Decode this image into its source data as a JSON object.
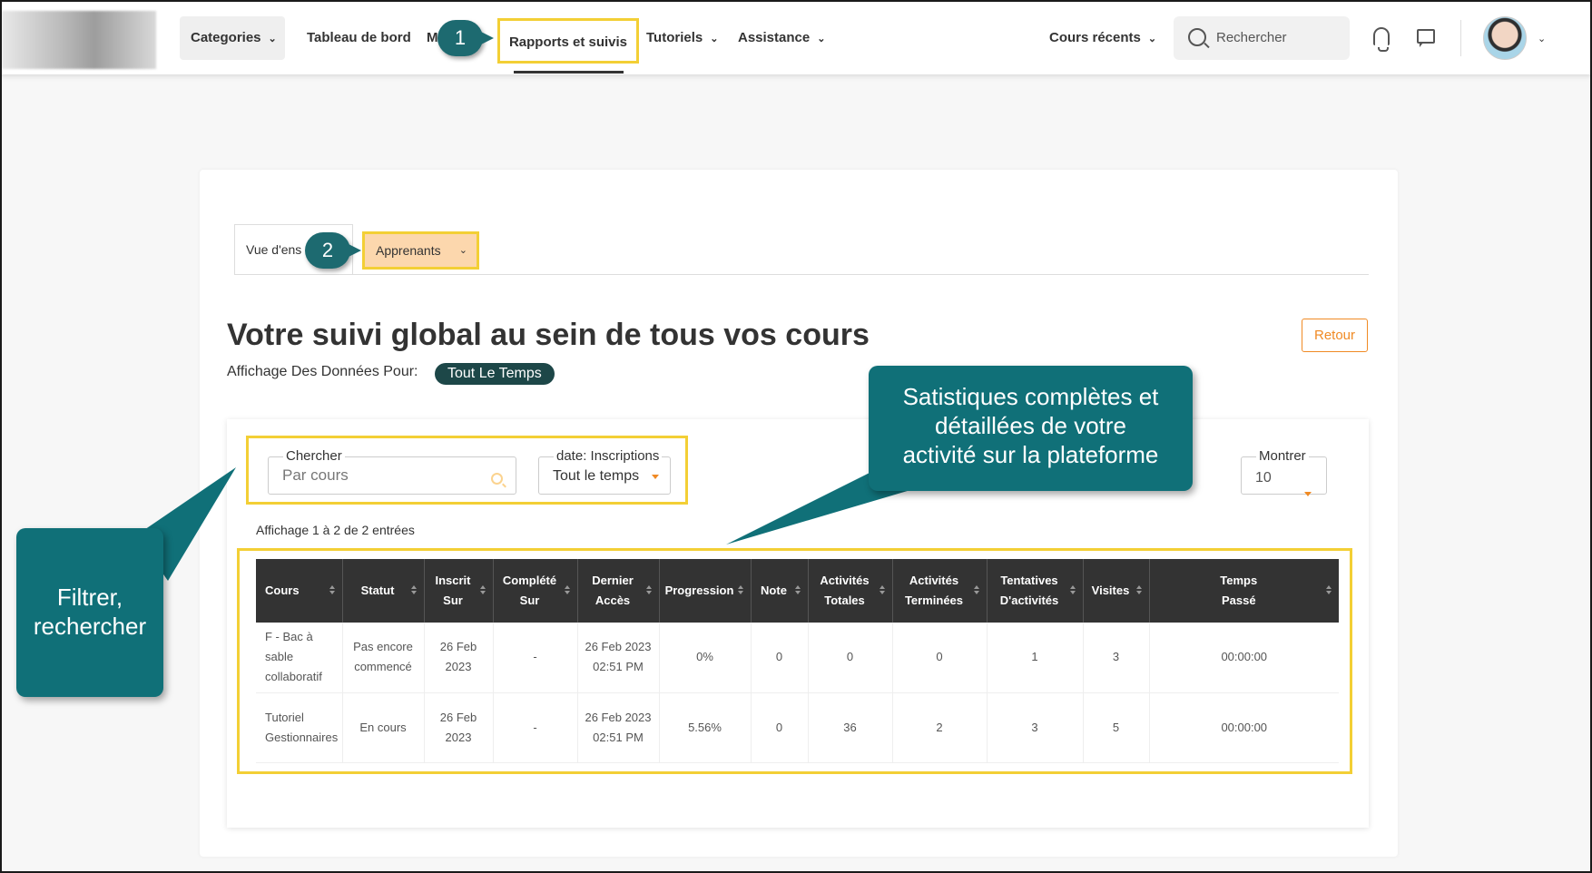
{
  "navbar": {
    "items": [
      {
        "label": "Categories"
      },
      {
        "label": "Tableau de bord"
      },
      {
        "label": "M"
      },
      {
        "label": "Rapports et suivis"
      },
      {
        "label": "Tutoriels"
      },
      {
        "label": "Assistance"
      },
      {
        "label": "Cours récents"
      }
    ],
    "search_placeholder": "Rechercher",
    "icons": [
      "search-icon",
      "bell-icon",
      "chat-icon",
      "avatar",
      "chevron-down-icon"
    ]
  },
  "tabs": [
    {
      "label": "Vue d'ens"
    },
    {
      "label": "Apprenants"
    }
  ],
  "page": {
    "title": "Votre suivi global au sein de tous vos cours",
    "affichage_label": "Affichage Des Données Pour:",
    "time_badge": "Tout Le Temps",
    "retour_label": "Retour"
  },
  "filters": {
    "search": {
      "legend": "Chercher",
      "placeholder": "Par cours"
    },
    "date": {
      "legend": "date: Inscriptions",
      "value": "Tout le temps"
    },
    "show": {
      "legend": "Montrer",
      "value": "10"
    }
  },
  "entries_info": "Affichage 1 à 2 de 2 entrées",
  "table": {
    "headers": [
      [
        "Cours"
      ],
      [
        "Statut"
      ],
      [
        "Inscrit",
        "Sur"
      ],
      [
        "Complété",
        "Sur"
      ],
      [
        "Dernier",
        "Accès"
      ],
      [
        "Progression"
      ],
      [
        "Note"
      ],
      [
        "Activités",
        "Totales"
      ],
      [
        "Activités",
        "Terminées"
      ],
      [
        "Tentatives",
        "D'activités"
      ],
      [
        "Visites"
      ],
      [
        "Temps",
        "Passé"
      ]
    ],
    "rows": [
      [
        [
          "F - Bac à sable",
          "collaboratif"
        ],
        [
          "Pas encore",
          "commencé"
        ],
        [
          "26 Feb",
          "2023"
        ],
        [
          "-"
        ],
        [
          "26 Feb 2023",
          "02:51 PM"
        ],
        [
          "0%"
        ],
        [
          "0"
        ],
        [
          "0"
        ],
        [
          "0"
        ],
        [
          "1"
        ],
        [
          "3"
        ],
        [
          "00:00:00"
        ]
      ],
      [
        [
          "Tutoriel",
          "Gestionnaires"
        ],
        [
          "En cours"
        ],
        [
          "26 Feb",
          "2023"
        ],
        [
          "-"
        ],
        [
          "26 Feb 2023",
          "02:51 PM"
        ],
        [
          "5.56%"
        ],
        [
          "0"
        ],
        [
          "36"
        ],
        [
          "2"
        ],
        [
          "3"
        ],
        [
          "5"
        ],
        [
          "00:00:00"
        ]
      ]
    ]
  },
  "annotations": {
    "step1": "1",
    "step2": "2",
    "stats_bubble": [
      "Satistiques complètes et",
      "détaillées de votre",
      "activité sur la plateforme"
    ],
    "filter_bubble": [
      "Filtrer,",
      "rechercher"
    ],
    "bubble_color": "#107078",
    "highlight_color": "#f3cf35"
  },
  "colors": {
    "accent": "#f08a24",
    "header_dark": "#333333",
    "badge_dark": "#1d4748",
    "tab_active_bg": "#fcd7ad"
  }
}
